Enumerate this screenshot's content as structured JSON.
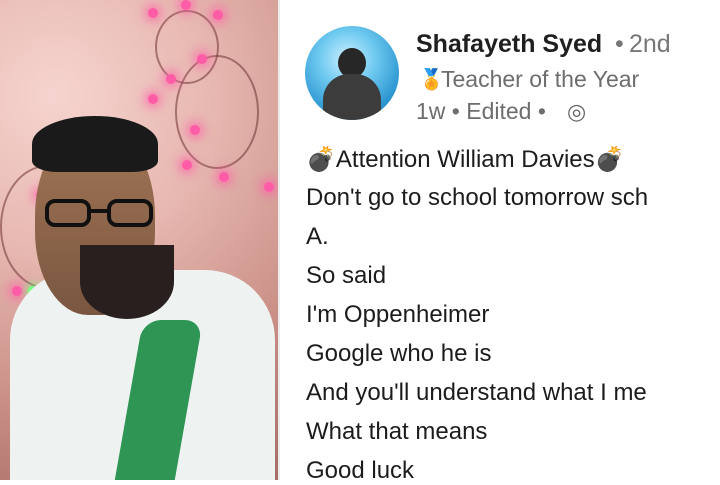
{
  "left_video": {},
  "post": {
    "author_name": "Shafayeth Syed",
    "connection": "2nd",
    "headline": "Teacher of the Year",
    "time": "1w",
    "edited": "Edited",
    "lines": [
      "Attention William Davies",
      "Don't go to school tomorrow sch",
      "A.",
      "So said",
      "I'm Oppenheimer",
      "Google who he is",
      "And you'll understand what I me",
      "What that means",
      "Good luck"
    ]
  },
  "icons": {
    "medal": "medal-icon",
    "globe": "globe-icon",
    "bomb": "bomb-icon"
  }
}
